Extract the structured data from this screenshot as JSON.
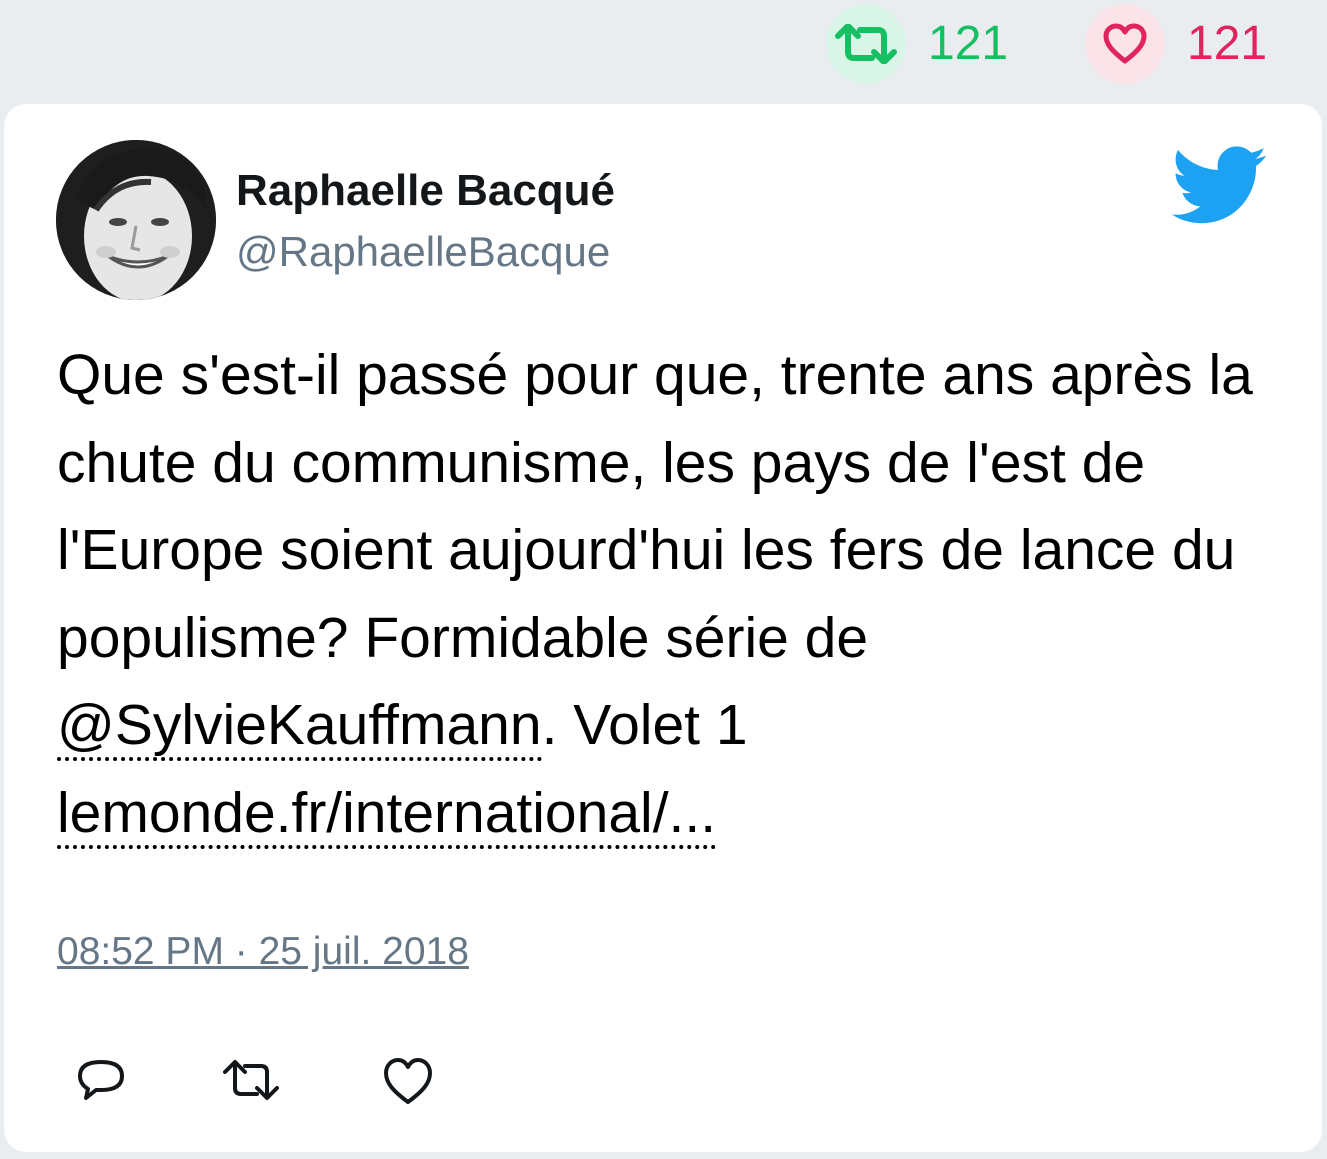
{
  "stats": {
    "retweets": "121",
    "likes": "121",
    "retweet_icon": "retweet-icon",
    "like_icon": "heart-icon",
    "retweet_color": "#17bf63",
    "like_color": "#e0245e"
  },
  "tweet": {
    "author_name": "Raphaelle Bacqué",
    "author_handle": "@RaphaelleBacque",
    "text_part1": "Que s'est-il passé pour que, trente ans après la chute du communisme, les pays de l'est de l'Europe soient aujourd'hui les fers de lance du populisme? Formidable série de ",
    "mention": "@SylvieKauffmann",
    "text_part2": ". Volet 1",
    "link": "lemonde.fr/international/...",
    "timestamp": "08:52 PM · 25 juil. 2018",
    "brand_icon": "twitter-bird-icon",
    "brand_color": "#1da1f2"
  },
  "actions": {
    "reply_icon": "reply-icon",
    "retweet_icon": "retweet-icon",
    "like_icon": "heart-icon"
  }
}
